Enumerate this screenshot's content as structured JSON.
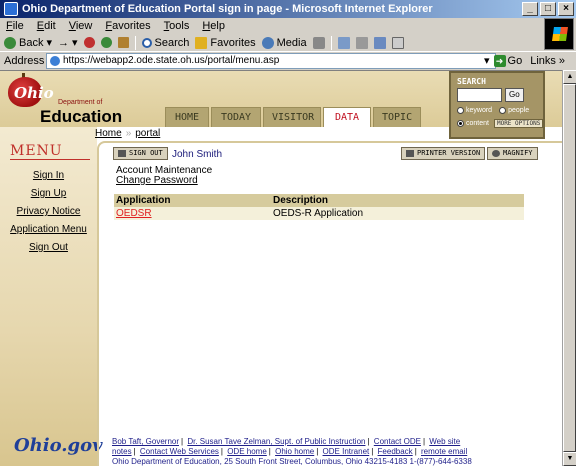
{
  "window": {
    "title": "Ohio Department of Education Portal sign in page - Microsoft Internet Explorer",
    "controls": [
      "_",
      "□",
      "×"
    ]
  },
  "menubar": [
    "File",
    "Edit",
    "View",
    "Favorites",
    "Tools",
    "Help"
  ],
  "toolbar": {
    "back": "Back",
    "search": "Search",
    "favorites": "Favorites",
    "media": "Media"
  },
  "address": {
    "label": "Address",
    "url": "https://webapp2.ode.state.oh.us/portal/menu.asp",
    "go": "Go",
    "links": "Links"
  },
  "header": {
    "logo_ohio": "Ohio",
    "logo_dept": "Department of",
    "logo_edu": "Education",
    "tabs": [
      {
        "label": "HOME"
      },
      {
        "label": "TODAY"
      },
      {
        "label": "VISITOR"
      },
      {
        "label": "DATA"
      },
      {
        "label": "TOPIC"
      }
    ],
    "active_tab": "DATA"
  },
  "search": {
    "title": "SEARCH",
    "go": "Go",
    "opt_keyword": "keyword",
    "opt_people": "people",
    "opt_content": "content",
    "more_options": "MORE OPTIONS"
  },
  "menu": {
    "title": "MENU",
    "items": [
      {
        "label": "Sign In"
      },
      {
        "label": "Sign Up"
      },
      {
        "label": "Privacy Notice"
      },
      {
        "label": "Application Menu"
      },
      {
        "label": "Sign Out"
      }
    ],
    "ohiogov": "Ohio.gov"
  },
  "breadcrumb": {
    "home": "Home",
    "portal": "portal"
  },
  "user": {
    "sign_out": "SIGN OUT",
    "name": "John Smith",
    "printer_version": "PRINTER VERSION",
    "magnify": "MAGNIFY"
  },
  "account": {
    "title": "Account Maintenance",
    "change_password": "Change Password"
  },
  "apps_table": {
    "headers": [
      "Application",
      "Description"
    ],
    "rows": [
      {
        "application": "OEDSR",
        "description": "OEDS-R Application"
      }
    ]
  },
  "footer": {
    "line1_a": "Bob Taft, Governor",
    "line1_b": "Dr. Susan Tave Zelman, Supt. of Public Instruction",
    "line1_c": "Contact ODE",
    "line1_d": "Web site",
    "line2_a": "notes",
    "line2_b": "Contact Web Services",
    "line2_c": "ODE home",
    "line2_d": "Ohio home",
    "line2_e": "ODE Intranet",
    "line2_f": "Feedback",
    "line2_g": "remote email",
    "address": "Ohio Department of Education, 25 South Front Street, Columbus, Ohio 43215-4183 1-(877)-644-6338"
  }
}
